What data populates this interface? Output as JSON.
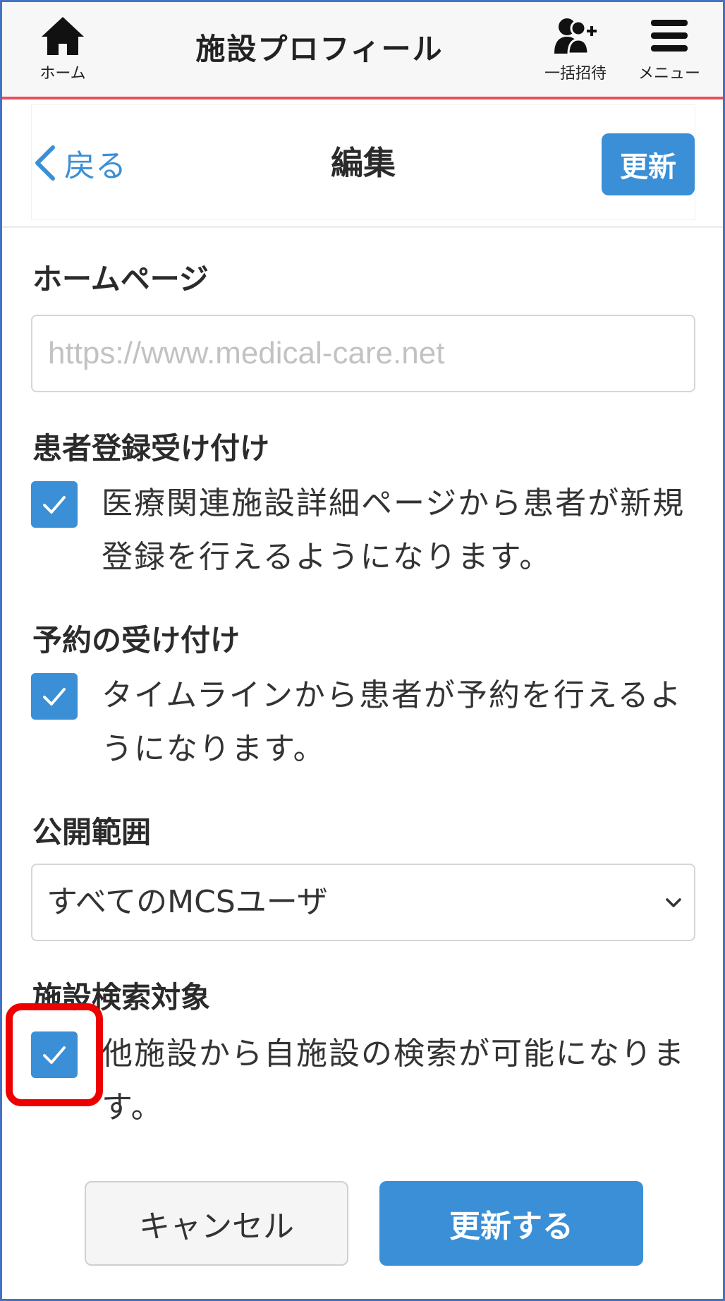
{
  "colors": {
    "accent": "#3a8fd6",
    "topbar_border": "#e8505b",
    "highlight": "#ee0000"
  },
  "topbar": {
    "title": "施設プロフィール",
    "home": {
      "icon": "home-icon",
      "label": "ホーム"
    },
    "invite": {
      "icon": "add-users-icon",
      "label": "一括招待"
    },
    "menu": {
      "icon": "hamburger-menu-icon",
      "label": "メニュー"
    }
  },
  "subheader": {
    "back_label": "戻る",
    "title": "編集",
    "update_label": "更新"
  },
  "form": {
    "homepage": {
      "label": "ホームページ",
      "value": "",
      "placeholder": "https://www.medical-care.net"
    },
    "patient_registration": {
      "label": "患者登録受け付け",
      "checked": true,
      "description": "医療関連施設詳細ページから患者が新規登録を行えるようになります。"
    },
    "reservation": {
      "label": "予約の受け付け",
      "checked": true,
      "description": "タイムラインから患者が予約を行えるようになります。"
    },
    "visibility": {
      "label": "公開範囲",
      "selected": "すべてのMCSユーザ"
    },
    "search_target": {
      "label": "施設検索対象",
      "checked": true,
      "description": "他施設から自施設の検索が可能になります。"
    }
  },
  "footer": {
    "cancel_label": "キャンセル",
    "submit_label": "更新する"
  }
}
